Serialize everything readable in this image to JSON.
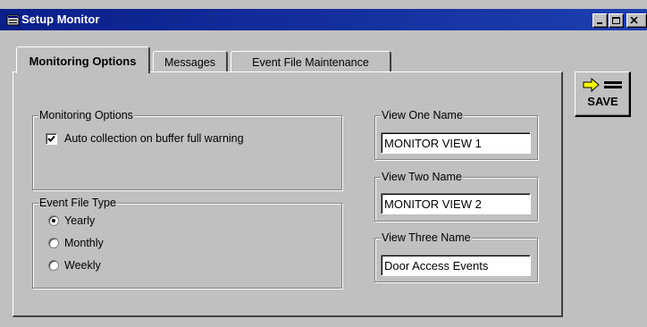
{
  "window": {
    "title": "Setup Monitor",
    "controls": [
      "minimize",
      "maximize",
      "close"
    ]
  },
  "tabs": [
    {
      "label": "Monitoring Options",
      "active": true
    },
    {
      "label": "Messages",
      "active": false
    },
    {
      "label": "Event File Maintenance",
      "active": false
    }
  ],
  "monitoring_options": {
    "group_label": "Monitoring Options",
    "auto_collection": {
      "label": "Auto collection on buffer full warning",
      "checked": true
    }
  },
  "event_file_type": {
    "group_label": "Event File Type",
    "options": [
      {
        "label": "Yearly",
        "selected": true
      },
      {
        "label": "Monthly",
        "selected": false
      },
      {
        "label": "Weekly",
        "selected": false
      }
    ]
  },
  "views": {
    "view_one": {
      "label": "View One Name",
      "value": "MONITOR VIEW  1"
    },
    "view_two": {
      "label": "View Two Name",
      "value": "MONITOR VIEW  2"
    },
    "view_three": {
      "label": "View Three Name",
      "value": "Door Access Events"
    }
  },
  "save_button": {
    "label": "SAVE",
    "icon": "arrow-to-slot-icon"
  },
  "colors": {
    "titlebar": "#0a1f8a",
    "face": "#c0c0c0",
    "arrow": "#ffff00"
  }
}
